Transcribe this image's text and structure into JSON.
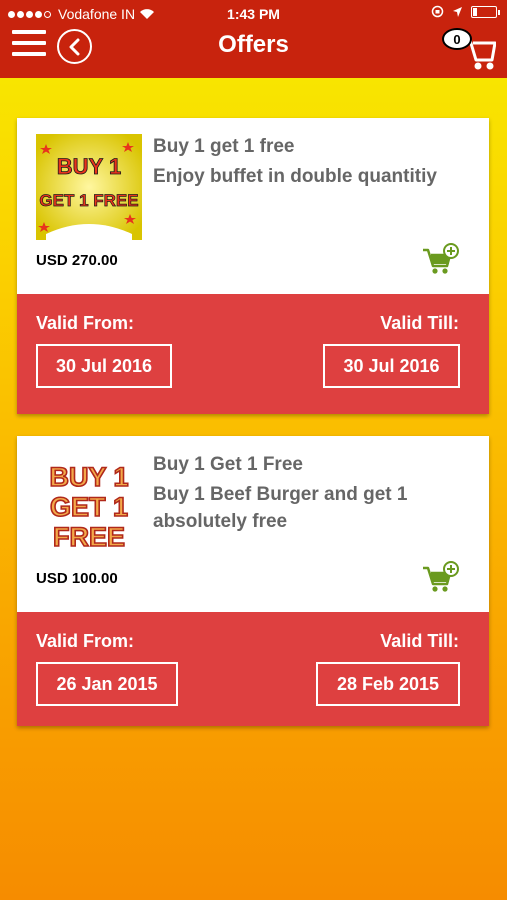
{
  "status_bar": {
    "carrier": "Vodafone IN",
    "time": "1:43 PM"
  },
  "header": {
    "title": "Offers",
    "cart_count": "0"
  },
  "colors": {
    "header_bg": "#c8230d",
    "validity_bg": "#de4040",
    "cart_icon": "#6a9a1f"
  },
  "offers": [
    {
      "title": "Buy 1 get 1 free",
      "description": "Enjoy buffet in double quantitiy",
      "price": "USD 270.00",
      "valid_from_label": "Valid From:",
      "valid_till_label": "Valid Till:",
      "valid_from": "30 Jul 2016",
      "valid_till": "30 Jul 2016",
      "image_text": [
        "BUY 1",
        "GET 1 FREE"
      ]
    },
    {
      "title": "Buy 1 Get 1 Free",
      "description": "Buy 1 Beef Burger and get 1 absolutely free",
      "price": "USD 100.00",
      "valid_from_label": "Valid From:",
      "valid_till_label": "Valid Till:",
      "valid_from": "26 Jan 2015",
      "valid_till": "28 Feb 2015",
      "image_text": [
        "BUY 1",
        "GET 1",
        "FREE"
      ]
    }
  ]
}
